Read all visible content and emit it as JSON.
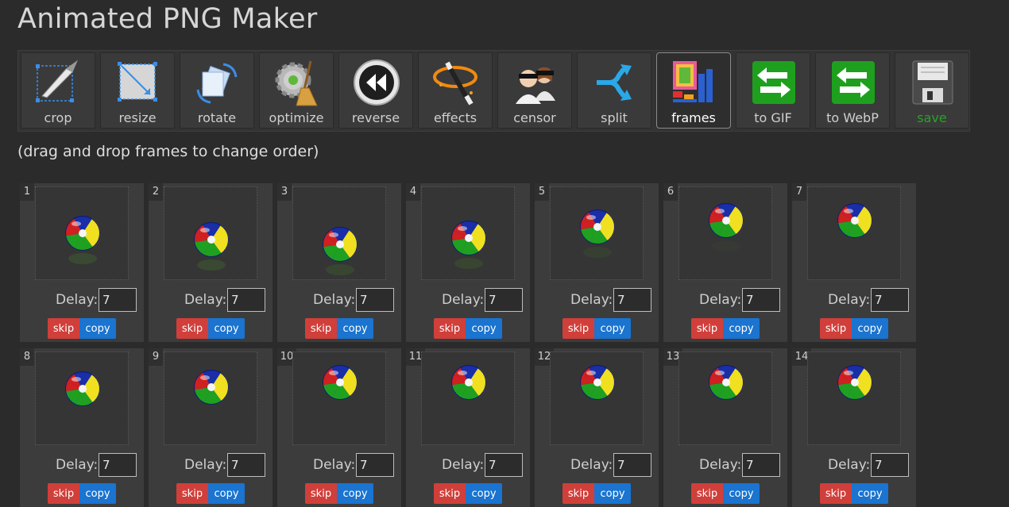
{
  "app": {
    "title": "Animated PNG Maker"
  },
  "toolbar": {
    "items": [
      {
        "label": "crop",
        "icon": "crop-icon"
      },
      {
        "label": "resize",
        "icon": "resize-icon"
      },
      {
        "label": "rotate",
        "icon": "rotate-icon"
      },
      {
        "label": "optimize",
        "icon": "optimize-icon"
      },
      {
        "label": "reverse",
        "icon": "reverse-icon"
      },
      {
        "label": "effects",
        "icon": "effects-icon"
      },
      {
        "label": "censor",
        "icon": "censor-icon"
      },
      {
        "label": "split",
        "icon": "split-icon"
      },
      {
        "label": "frames",
        "icon": "frames-icon",
        "active": true
      },
      {
        "label": "to GIF",
        "icon": "convert-gif-icon"
      },
      {
        "label": "to WebP",
        "icon": "convert-webp-icon"
      },
      {
        "label": "save",
        "icon": "save-icon"
      }
    ]
  },
  "instructions": "(drag and drop frames to change order)",
  "frame_labels": {
    "delay": "Delay:",
    "skip": "skip",
    "copy": "copy"
  },
  "frames": [
    {
      "number": "1",
      "delay": "7"
    },
    {
      "number": "2",
      "delay": "7"
    },
    {
      "number": "3",
      "delay": "7"
    },
    {
      "number": "4",
      "delay": "7"
    },
    {
      "number": "5",
      "delay": "7"
    },
    {
      "number": "6",
      "delay": "7"
    },
    {
      "number": "7",
      "delay": "7"
    },
    {
      "number": "8",
      "delay": "7"
    },
    {
      "number": "9",
      "delay": "7"
    },
    {
      "number": "10",
      "delay": "7"
    },
    {
      "number": "11",
      "delay": "7"
    },
    {
      "number": "12",
      "delay": "7"
    },
    {
      "number": "13",
      "delay": "7"
    },
    {
      "number": "14",
      "delay": "7"
    }
  ],
  "colors": {
    "background": "#2b2b2b",
    "skip_button": "#d13f3a",
    "copy_button": "#1a74d0",
    "save_label": "#2aa02a"
  }
}
